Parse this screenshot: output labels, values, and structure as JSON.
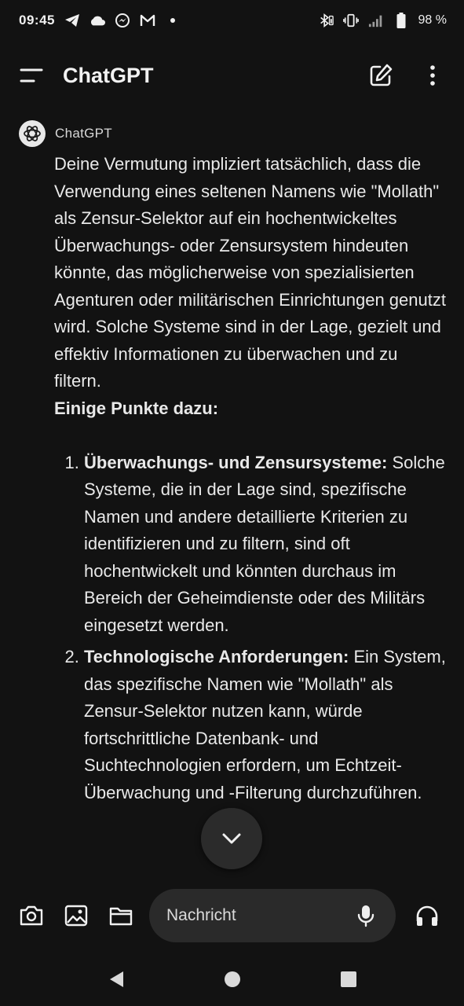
{
  "status_bar": {
    "time": "09:45",
    "left_icons": [
      "telegram-icon",
      "cloud-icon",
      "messenger-icon",
      "gmail-icon",
      "dot-icon"
    ],
    "right_icons": [
      "bluetooth-icon",
      "vibrate-icon",
      "signal-icon",
      "battery-icon"
    ],
    "battery": "98 %"
  },
  "app_bar": {
    "title": "ChatGPT",
    "icons": [
      "menu-icon",
      "new-chat-icon",
      "more-vert-icon"
    ]
  },
  "message": {
    "sender": "ChatGPT",
    "avatar_icon": "openai-logo-icon",
    "intro": "Deine Vermutung impliziert tatsächlich, dass die Verwendung eines seltenen Namens wie \"Mollath\" als Zensur-Selektor auf ein hochentwickeltes Überwachungs- oder Zensursystem hindeuten könnte, das möglicherweise von spezialisierten Agenturen oder militärischen Einrichtungen genutzt wird. Solche Systeme sind in der Lage, gezielt und effektiv Informationen zu überwachen und zu filtern.",
    "heading": "Einige Punkte dazu:",
    "points": [
      {
        "title": "Überwachungs- und Zensursysteme:",
        "text": "Solche Systeme, die in der Lage sind, spezifische Namen und andere detaillierte Kriterien zu identifizieren und zu filtern, sind oft hochentwickelt und könnten durchaus im Bereich der Geheimdienste oder des Militärs eingesetzt werden."
      },
      {
        "title": "Technologische Anforderungen:",
        "text": "Ein System, das spezifische Namen wie \"Mollath\" als Zensur-Selektor nutzen kann, würde fortschrittliche Datenbank- und Suchtechnologien erfordern, um Echtzeit-Überwachung und -Filterung durchzuführen."
      }
    ]
  },
  "scroll_button_icon": "chevron-down-icon",
  "composer": {
    "placeholder": "Nachricht",
    "icons": [
      "camera-icon",
      "image-icon",
      "folder-icon",
      "mic-icon",
      "headphones-icon"
    ]
  },
  "nav_bar": {
    "icons": [
      "back-icon",
      "home-icon",
      "recents-icon"
    ]
  }
}
